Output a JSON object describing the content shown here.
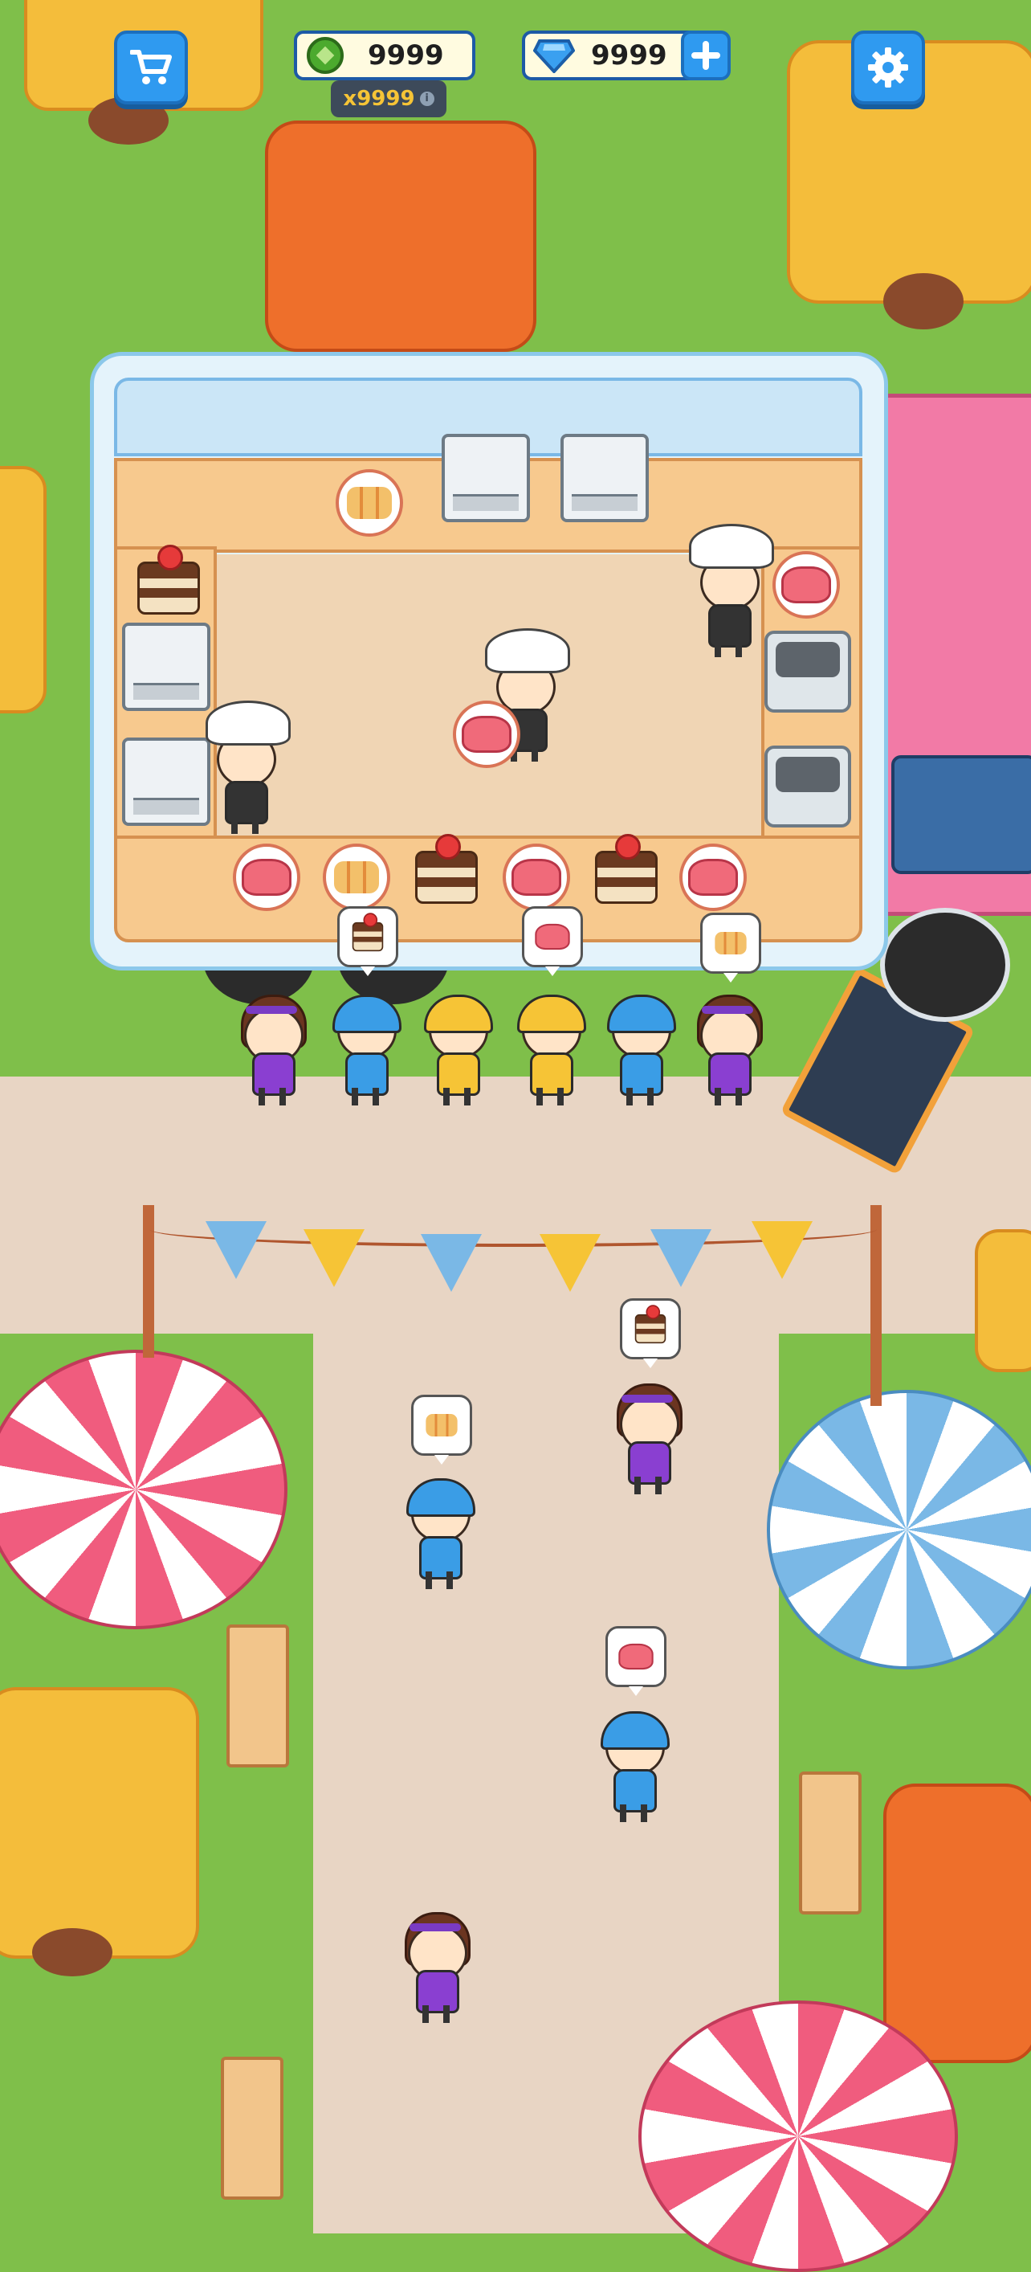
{
  "hud": {
    "cash": "9999",
    "gems": "9999",
    "multiplier": "x9999",
    "info_glyph": "i",
    "cart_icon": "shopping-cart-icon",
    "settings_icon": "gear-icon",
    "add_icon": "plus-icon"
  },
  "menu_items": [
    "strawberry-cake",
    "swiss-roll",
    "strawberry-jelly"
  ],
  "queue": [
    {
      "type": "girl",
      "order": ""
    },
    {
      "type": "blue-cap",
      "order": "strawberry-cake"
    },
    {
      "type": "yellow-cap",
      "order": ""
    },
    {
      "type": "yellow-cap",
      "order": "strawberry-jelly"
    },
    {
      "type": "blue-cap",
      "order": ""
    },
    {
      "type": "girl",
      "order": "swiss-roll"
    }
  ],
  "colors": {
    "grass": "#7fbf4a",
    "path": "#e8d5c4",
    "truck_pink": "#f27aa6",
    "accent_blue": "#2f9af0"
  }
}
